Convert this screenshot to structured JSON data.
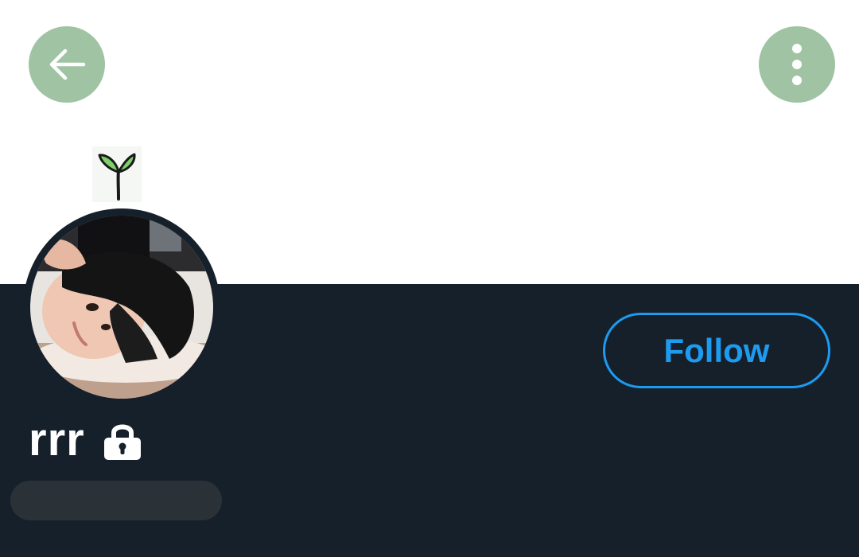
{
  "header": {
    "back_icon": "arrow-left-icon",
    "more_icon": "more-vertical-icon",
    "button_color": "#9fc3a3"
  },
  "banner": {
    "background": "#ffffff",
    "decoration_icon": "sprout-icon"
  },
  "profile": {
    "display_name": "rrr",
    "protected_icon": "lock-icon",
    "follow_label": "Follow",
    "accent_color": "#1d9bf0",
    "background": "#16202b"
  }
}
